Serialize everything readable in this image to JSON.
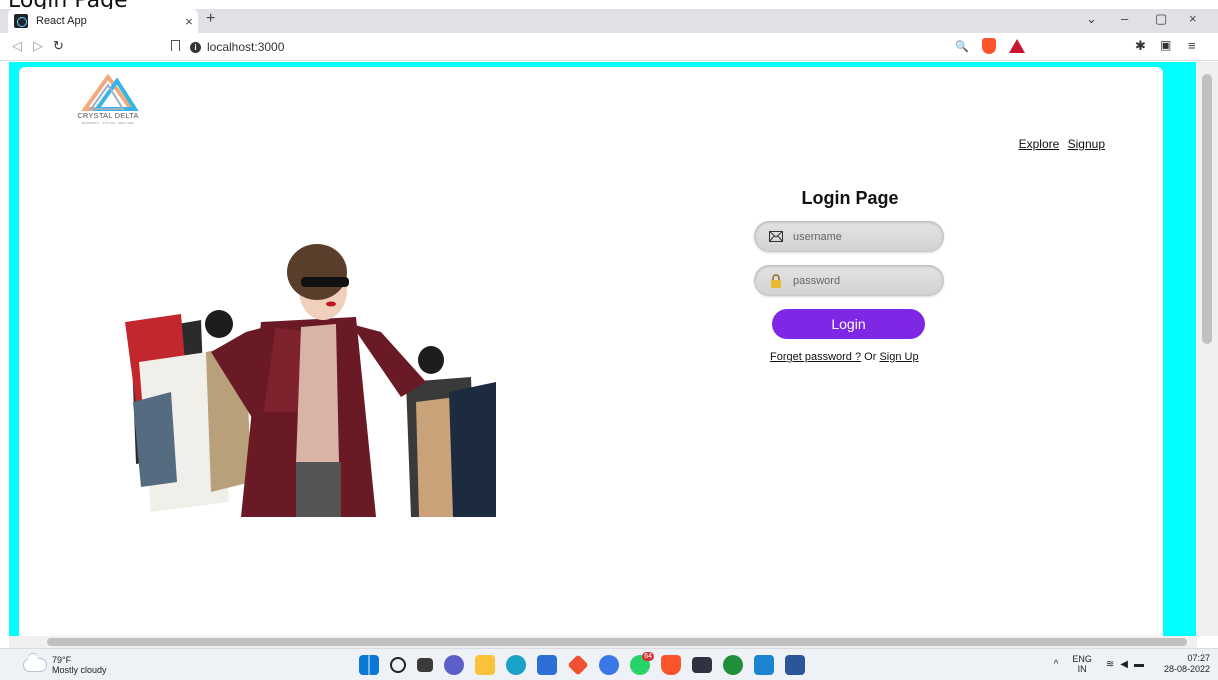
{
  "document_caption": "Login Page",
  "browser": {
    "tab_title": "React App",
    "tab_close": "×",
    "new_tab": "+",
    "url": "localhost:3000",
    "window_controls": [
      "⌄",
      "–",
      "▢",
      "×"
    ]
  },
  "site": {
    "logo_text": "CRYSTAL DELTA",
    "logo_tagline": "MODERNITY · STYLING · NEW YORK",
    "nav": {
      "explore": "Explore",
      "signup": "Signup"
    },
    "photo_alt": "woman holding shopping bags"
  },
  "login": {
    "title": "Login Page",
    "username_placeholder": "username",
    "password_placeholder": "password",
    "button_label": "Login",
    "forgot_label": "Forget password ?",
    "or_text": " Or ",
    "signup_link": "Sign Up",
    "accent_color": "#7e28e6",
    "page_background": "#00ffff"
  },
  "taskbar": {
    "weather_temp": "79°F",
    "weather_desc": "Mostly cloudy",
    "lang_top": "ENG",
    "lang_bottom": "IN",
    "time": "07:27",
    "date": "28-08-2022",
    "whatsapp_badge": "64",
    "apps": [
      "start-icon",
      "search-icon",
      "task-view-icon",
      "teams-icon",
      "file-explorer-icon",
      "edge-icon",
      "store-icon",
      "git-icon",
      "chrome-canary-icon",
      "whatsapp-icon",
      "brave-icon",
      "terminal-icon",
      "node-icon",
      "vscode-icon",
      "word-icon"
    ]
  }
}
